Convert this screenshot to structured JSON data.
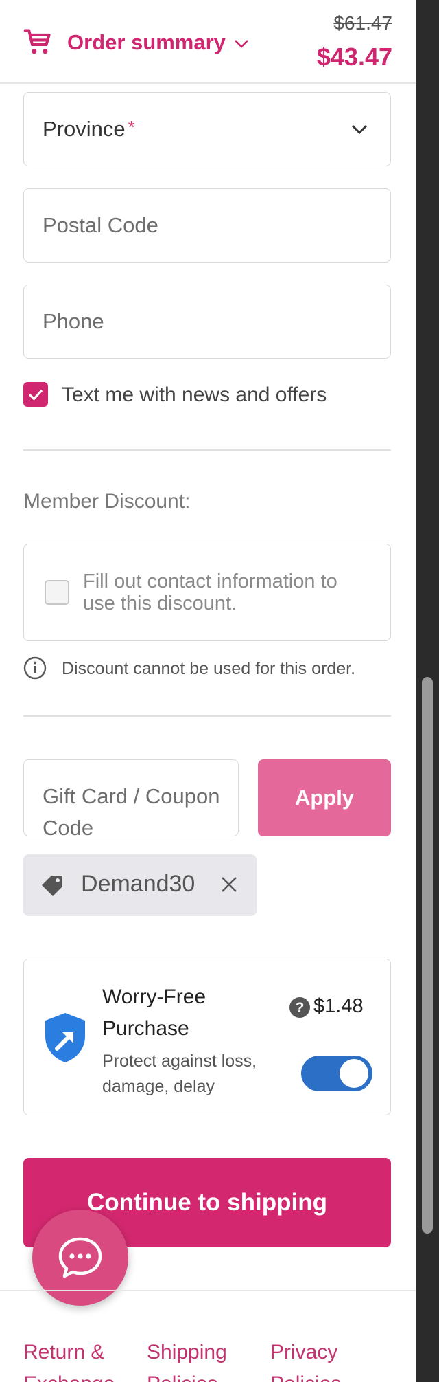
{
  "header": {
    "summary_label": "Order summary",
    "original_price": "$61.47",
    "total_price": "$43.47"
  },
  "form": {
    "province_label": "Province",
    "required_mark": "*",
    "postal_placeholder": "Postal Code",
    "phone_placeholder": "Phone",
    "marketing_checkbox_label": "Text me with news and offers",
    "marketing_checked": true
  },
  "member_discount": {
    "label": "Member Discount:",
    "checkbox_text": "Fill out contact information to use this discount.",
    "info_text": "Discount cannot be used for this order."
  },
  "coupon": {
    "placeholder": "Gift Card / Coupon Code",
    "apply_label": "Apply",
    "applied_code": "Demand30"
  },
  "protection": {
    "title": "Worry-Free Purchase",
    "subtitle": "Protect against loss, damage, delay",
    "price": "$1.48",
    "enabled": true
  },
  "continue_label": "Continue to shipping",
  "footer": {
    "links": [
      "Return & Exchange",
      "Shipping Policies",
      "Privacy Policies"
    ]
  },
  "colors": {
    "brand": "#d0266f",
    "apply_button": "#e4699a",
    "toggle_on": "#2b6fc7",
    "shield": "#2b7de0"
  },
  "icons": {
    "cart": "cart-icon",
    "chevron": "chevron-down-icon",
    "info": "info-icon",
    "tag": "tag-icon",
    "remove": "close-icon",
    "shield": "shield-icon",
    "help": "help-icon",
    "chat": "chat-icon"
  }
}
